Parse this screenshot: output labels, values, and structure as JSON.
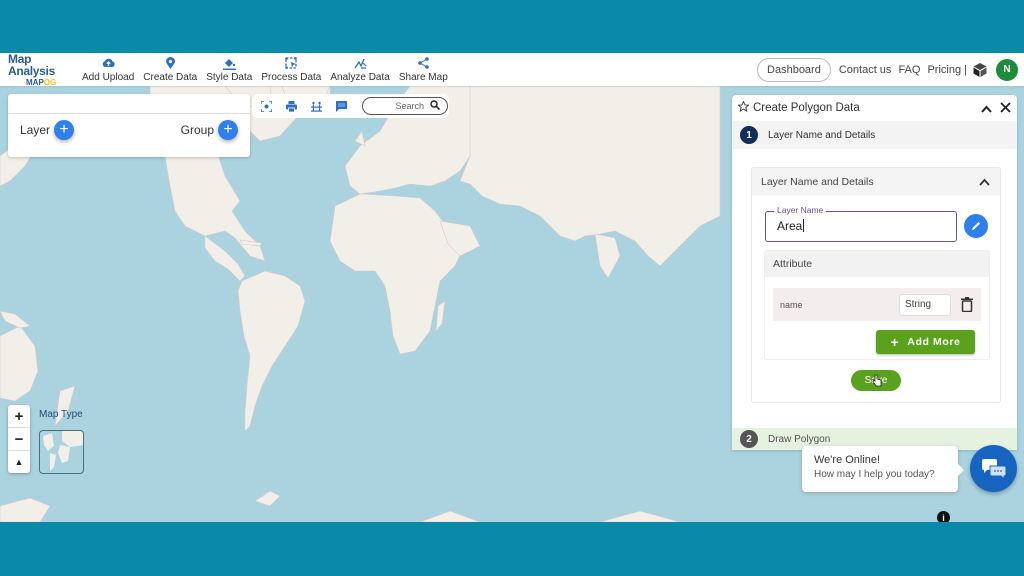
{
  "header": {
    "logo_title": "Map Analysis",
    "logo_sub_a": "MAP",
    "logo_sub_b": "OG",
    "nav": [
      {
        "icon": "cloud-upload-icon",
        "label": "Add Upload"
      },
      {
        "icon": "map-pin-icon",
        "label": "Create Data"
      },
      {
        "icon": "paint-bucket-icon",
        "label": "Style Data"
      },
      {
        "icon": "process-icon",
        "label": "Process Data"
      },
      {
        "icon": "analyze-icon",
        "label": "Analyze Data"
      },
      {
        "icon": "share-icon",
        "label": "Share Map"
      }
    ],
    "dashboard_label": "Dashboard",
    "contact_label": "Contact us",
    "faq_label": "FAQ",
    "pricing_label": "Pricing |",
    "avatar_initial": "N",
    "avatar_color": "#1e8c3a"
  },
  "layer_panel": {
    "layer_label": "Layer",
    "group_label": "Group"
  },
  "toolbar": {
    "icons": [
      "focus-icon",
      "print-icon",
      "measure-icon",
      "comment-icon"
    ],
    "search_placeholder": "Search"
  },
  "map_controls": {
    "zoom_in": "+",
    "zoom_out": "−",
    "compass": "▲",
    "map_type_label": "Map Type"
  },
  "create_panel": {
    "title": "Create Polygon Data",
    "step1": {
      "number": "1",
      "label": "Layer Name and Details"
    },
    "accordion_title": "Layer Name and Details",
    "layer_name_label": "Layer Name",
    "layer_name_value": "Area",
    "attribute_header": "Attribute",
    "attributes": [
      {
        "name": "name",
        "type": "String"
      }
    ],
    "add_more_label": "Add More",
    "save_label": "Save",
    "step2": {
      "number": "2",
      "label": "Draw Polygon"
    }
  },
  "chat": {
    "line1": "We're Online!",
    "line2": "How may I help you today?"
  },
  "colors": {
    "frame": "#0a8aa8",
    "ocean": "#aad3df",
    "land": "#f2efe9",
    "accent_blue": "#2f80ed",
    "action_green": "#5aa21d",
    "step_active": "#0f2f5a"
  }
}
